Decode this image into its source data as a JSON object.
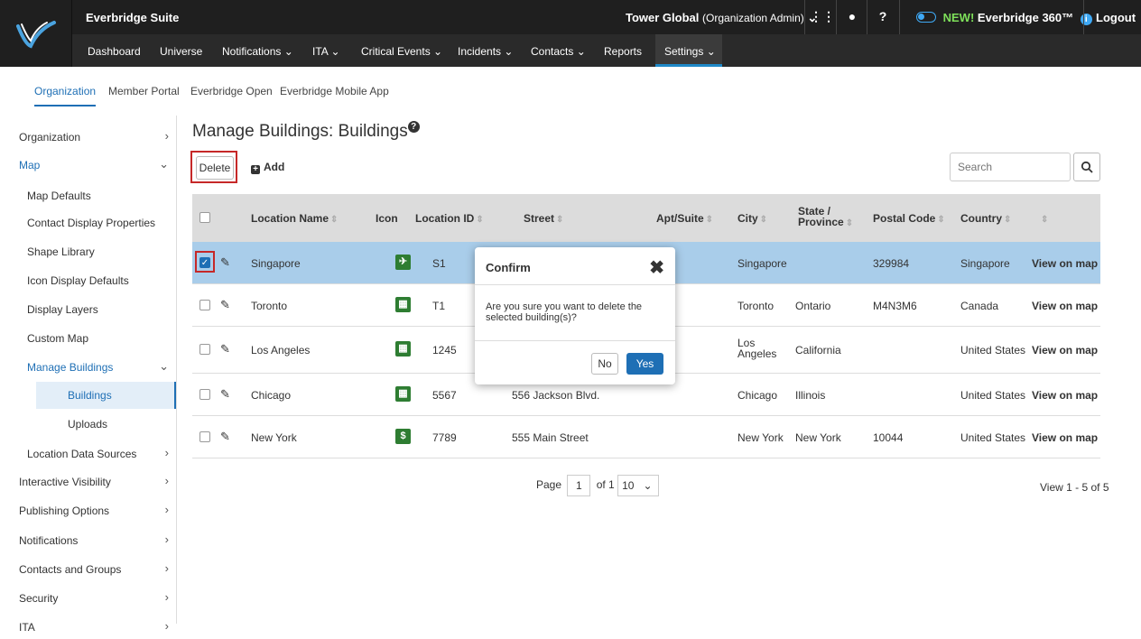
{
  "app_title": "Everbridge Suite",
  "org": {
    "name": "Tower Global",
    "role": "(Organization Admin)",
    "caret": "⌄"
  },
  "topbar": {
    "grid_icon": "⋮⋮",
    "user_icon": "●",
    "help_icon": "?",
    "new_label": "NEW!",
    "product": "Everbridge 360™",
    "info_icon": "i",
    "logout": "Logout"
  },
  "nav": [
    {
      "label": "Dashboard"
    },
    {
      "label": "Universe"
    },
    {
      "label": "Notifications ⌄"
    },
    {
      "label": "ITA ⌄"
    },
    {
      "label": "Critical Events ⌄"
    },
    {
      "label": "Incidents ⌄"
    },
    {
      "label": "Contacts ⌄"
    },
    {
      "label": "Reports"
    },
    {
      "label": "Settings ⌄"
    }
  ],
  "subnav": [
    {
      "label": "Organization"
    },
    {
      "label": "Member Portal"
    },
    {
      "label": "Everbridge Open"
    },
    {
      "label": "Everbridge Mobile App"
    }
  ],
  "sidebar": [
    {
      "label": "Organization",
      "chev": "›"
    },
    {
      "label": "Map",
      "chev": "⌄"
    },
    {
      "label": "Map Defaults",
      "chev": ""
    },
    {
      "label": "Contact Display Properties",
      "chev": ""
    },
    {
      "label": "Shape Library",
      "chev": ""
    },
    {
      "label": "Icon Display Defaults",
      "chev": ""
    },
    {
      "label": "Display Layers",
      "chev": ""
    },
    {
      "label": "Custom Map",
      "chev": ""
    },
    {
      "label": "Manage Buildings",
      "chev": "⌄"
    },
    {
      "label": "Buildings",
      "chev": ""
    },
    {
      "label": "Uploads",
      "chev": ""
    },
    {
      "label": "Location Data Sources",
      "chev": "›"
    },
    {
      "label": "Interactive Visibility",
      "chev": "›"
    },
    {
      "label": "Publishing Options",
      "chev": "›"
    },
    {
      "label": "Notifications",
      "chev": "›"
    },
    {
      "label": "Contacts and Groups",
      "chev": "›"
    },
    {
      "label": "Security",
      "chev": "›"
    },
    {
      "label": "ITA",
      "chev": "›"
    }
  ],
  "page": {
    "title": "Manage Buildings: Buildings",
    "help_icon": "?",
    "delete": "Delete",
    "add_icon": "+",
    "add": "Add",
    "search_placeholder": "Search",
    "search_icon": "⌕"
  },
  "table": {
    "headers": {
      "name": "Location Name",
      "icon": "Icon",
      "id": "Location ID",
      "street": "Street",
      "apt": "Apt/Suite",
      "city": "City",
      "state1": "State /",
      "state2": "Province",
      "postal": "Postal Code",
      "country": "Country",
      "sort": "⇕"
    },
    "rows": [
      {
        "check": "✓",
        "pencil": "✎",
        "icon": "✈",
        "name": "Singapore",
        "id": "S1",
        "street": "",
        "city": "Singapore",
        "city2": "",
        "state": "",
        "postal": "329984",
        "country": "Singapore",
        "view": "View on map"
      },
      {
        "check": "",
        "pencil": "✎",
        "icon": "▦",
        "name": "Toronto",
        "id": "T1",
        "street": "",
        "city": "Toronto",
        "city2": "",
        "state": "Ontario",
        "postal": "M4N3M6",
        "country": "Canada",
        "view": "View on map"
      },
      {
        "check": "",
        "pencil": "✎",
        "icon": "▦",
        "name": "Los Angeles",
        "id": "1245",
        "street": "",
        "city": "Los",
        "city2": "Angeles",
        "state": "California",
        "postal": "",
        "country": "United States",
        "view": "View on map"
      },
      {
        "check": "",
        "pencil": "✎",
        "icon": "▦",
        "name": "Chicago",
        "id": "5567",
        "street": "556 Jackson Blvd.",
        "city": "Chicago",
        "city2": "",
        "state": "Illinois",
        "postal": "",
        "country": "United States",
        "view": "View on map"
      },
      {
        "check": "",
        "pencil": "✎",
        "icon": "$",
        "name": "New York",
        "id": "7789",
        "street": "555 Main Street",
        "city": "New York",
        "city2": "",
        "state": "New York",
        "postal": "10044",
        "country": "United States",
        "view": "View on map"
      }
    ]
  },
  "pager": {
    "page_label": "Page",
    "page": "1",
    "of": "of 1",
    "size": "10",
    "caret": "⌄",
    "count": "View 1 - 5 of 5"
  },
  "modal": {
    "title": "Confirm",
    "close": "✖",
    "message": "Are you sure you want to delete the selected building(s)?",
    "no": "No",
    "yes": "Yes"
  }
}
